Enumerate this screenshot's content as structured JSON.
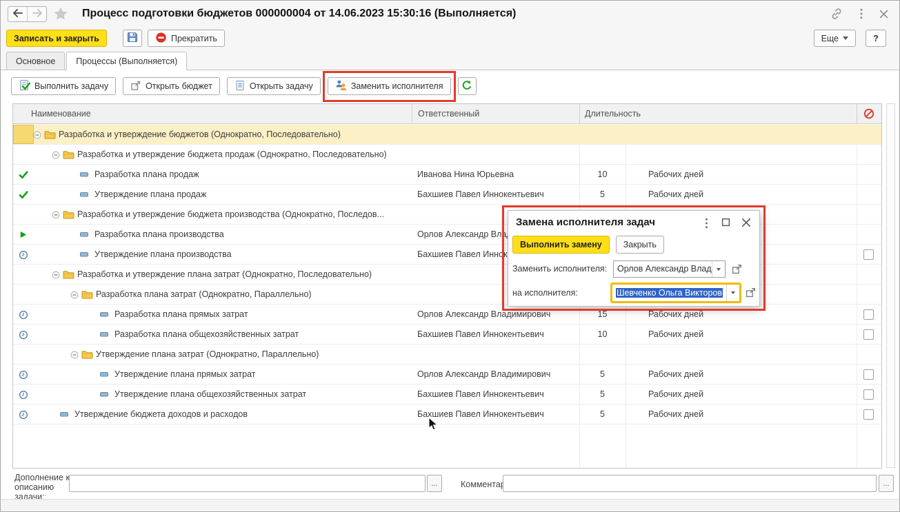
{
  "window": {
    "title": "Процесс подготовки бюджетов 000000004 от 14.06.2023 15:30:16 (Выполняется)"
  },
  "command_bar": {
    "save_and_close": "Записать и закрыть",
    "stop": "Прекратить",
    "more": "Еще",
    "help": "?"
  },
  "tabs": [
    {
      "label": "Основное",
      "active": false
    },
    {
      "label": "Процессы (Выполняется)",
      "active": true
    }
  ],
  "task_toolbar": {
    "execute_task": "Выполнить задачу",
    "open_budget": "Открыть бюджет",
    "open_task": "Открыть задачу",
    "replace_executor": "Заменить исполнителя"
  },
  "table": {
    "headers": {
      "name": "Наименование",
      "responsible": "Ответственный",
      "duration": "Длительность"
    },
    "rows": [
      {
        "kind": "group",
        "level": 0,
        "selected": true,
        "status": "",
        "name": "Разработка и утверждение бюджетов (Однократно, Последовательно)",
        "responsible": "",
        "duration": "",
        "unit": "",
        "checkbox": false
      },
      {
        "kind": "group",
        "level": 1,
        "selected": false,
        "status": "",
        "name": "Разработка и утверждение бюджета продаж (Однократно, Последовательно)",
        "responsible": "",
        "duration": "",
        "unit": "",
        "checkbox": false
      },
      {
        "kind": "task",
        "level": 2,
        "selected": false,
        "status": "done",
        "name": "Разработка плана продаж",
        "responsible": "Иванова Нина Юрьевна",
        "duration": "10",
        "unit": "Рабочих дней",
        "checkbox": false
      },
      {
        "kind": "task",
        "level": 2,
        "selected": false,
        "status": "done",
        "name": "Утверждение плана продаж",
        "responsible": "Бахшиев Павел Иннокентьевич",
        "duration": "5",
        "unit": "Рабочих дней",
        "checkbox": false
      },
      {
        "kind": "group",
        "level": 1,
        "selected": false,
        "status": "",
        "name": "Разработка и утверждение бюджета производства (Однократно, Последов...",
        "responsible": "",
        "duration": "",
        "unit": "",
        "checkbox": false
      },
      {
        "kind": "task",
        "level": 2,
        "selected": false,
        "status": "running",
        "name": "Разработка плана производства",
        "responsible": "Орлов Александр Владимирович",
        "duration": "",
        "unit": "",
        "checkbox": false
      },
      {
        "kind": "task",
        "level": 2,
        "selected": false,
        "status": "waiting",
        "name": "Утверждение плана производства",
        "responsible": "Бахшиев Павел Иннокентьевич",
        "duration": "",
        "unit": "",
        "checkbox": true
      },
      {
        "kind": "group",
        "level": 1,
        "selected": false,
        "status": "",
        "name": "Разработка и утверждение плана затрат (Однократно, Последовательно)",
        "responsible": "",
        "duration": "",
        "unit": "",
        "checkbox": false
      },
      {
        "kind": "group",
        "level": 2,
        "selected": false,
        "status": "",
        "name": "Разработка плана затрат (Однократно, Параллельно)",
        "responsible": "",
        "duration": "",
        "unit": "",
        "checkbox": false
      },
      {
        "kind": "task",
        "level": 3,
        "selected": false,
        "status": "waiting",
        "name": "Разработка плана прямых затрат",
        "responsible": "Орлов Александр Владимирович",
        "duration": "15",
        "unit": "Рабочих дней",
        "checkbox": true
      },
      {
        "kind": "task",
        "level": 3,
        "selected": false,
        "status": "waiting",
        "name": "Разработка плана общехозяйственных затрат",
        "responsible": "Бахшиев Павел Иннокентьевич",
        "duration": "10",
        "unit": "Рабочих дней",
        "checkbox": true
      },
      {
        "kind": "group",
        "level": 2,
        "selected": false,
        "status": "",
        "name": "Утверждение плана затрат (Однократно, Параллельно)",
        "responsible": "",
        "duration": "",
        "unit": "",
        "checkbox": false
      },
      {
        "kind": "task",
        "level": 3,
        "selected": false,
        "status": "waiting",
        "name": "Утверждение плана прямых затрат",
        "responsible": "Орлов Александр Владимирович",
        "duration": "5",
        "unit": "Рабочих дней",
        "checkbox": true
      },
      {
        "kind": "task",
        "level": 3,
        "selected": false,
        "status": "waiting",
        "name": "Утверждение плана общехозяйственных затрат",
        "responsible": "Бахшиев Павел Иннокентьевич",
        "duration": "5",
        "unit": "Рабочих дней",
        "checkbox": true
      },
      {
        "kind": "task",
        "level": 1,
        "selected": false,
        "status": "waiting",
        "name": "Утверждение бюджета доходов и расходов",
        "responsible": "Бахшиев Павел Иннокентьевич",
        "duration": "5",
        "unit": "Рабочих дней",
        "checkbox": true
      }
    ]
  },
  "dialog": {
    "title": "Замена исполнителя задач",
    "execute_button": "Выполнить замену",
    "close_button": "Закрыть",
    "replace_label": "Заменить исполнителя:",
    "replace_value": "Орлов Александр Владим",
    "to_label": "на исполнителя:",
    "to_value": "Шевченко Ольга Викторов"
  },
  "footer": {
    "addition_label": "Дополнение к описанию задачи:",
    "addition_value": "",
    "comment_label": "Комментарий:",
    "comment_value": "",
    "more_dots": "..."
  },
  "icons": [
    "back-arrow",
    "forward-arrow",
    "favorites-star",
    "link",
    "kebab-menu",
    "close",
    "save-floppy",
    "stop-circle",
    "more-caret",
    "execute-task-check",
    "open-budget",
    "open-task-doc",
    "replace-executor-people",
    "refresh",
    "prohibited",
    "expander-minus",
    "folder",
    "task-dash",
    "status-done-check",
    "status-running-play",
    "status-waiting-clock",
    "checkbox",
    "dropdown-caret",
    "open-value",
    "maximize-box",
    "mouse-cursor"
  ],
  "colors": {
    "accent_yellow": "#ffdf17",
    "annotation_red": "#e3392c",
    "selection_blue": "#2e63c8",
    "focus_gold": "#f0bb00",
    "selected_row": "#fbf0c6",
    "status_green": "#17a317",
    "waiting_blue": "#5a7fa6",
    "folder_yellow": "#f7c84d",
    "prohibit_red": "#d8473c"
  }
}
